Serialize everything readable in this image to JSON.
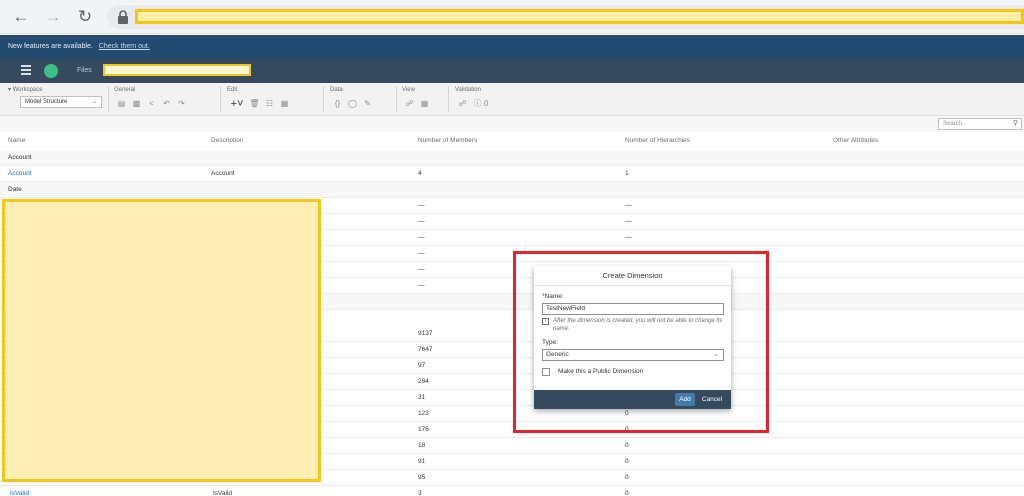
{
  "notice": {
    "text": "New features are available.",
    "link": "Check them out."
  },
  "header": {
    "breadcrumb_label": "Files"
  },
  "toolbar": {
    "workspace_label": "Workspace",
    "workspace_value": "Model Structure",
    "general_label": "General",
    "edit_label": "Edit",
    "data_label": "Data",
    "view_label": "View",
    "validation_label": "Validation",
    "validation_count": "0"
  },
  "search": {
    "placeholder": "Search"
  },
  "table": {
    "columns": [
      "Name",
      "Description",
      "Number of Members",
      "Number of Hierarchies",
      "Other Attributes"
    ],
    "group_account": "Account",
    "group_date": "Date",
    "account_row": {
      "name": "Account",
      "description": "Account",
      "members": "4",
      "hierarchies": "1"
    },
    "dash": "—",
    "members_visible": [
      "—",
      "—",
      "—",
      "—",
      "—",
      "—",
      "9137",
      "7647",
      "97",
      "284",
      "31",
      "123",
      "176",
      "18",
      "91",
      "95",
      "3"
    ],
    "hier_visible": [
      "—",
      "—",
      "—",
      "0",
      "0",
      "0",
      "0",
      "0",
      "0",
      "0"
    ],
    "last_row": {
      "name": "IsValid",
      "description": "IsValid",
      "members": "3",
      "hierarchies": "0"
    }
  },
  "dialog": {
    "title": "Create Dimension",
    "name_label": "Name:",
    "name_value": "TestNewField",
    "info_text": "After the dimension is created, you will not be able to change its name.",
    "type_label": "Type:",
    "type_value": "Generic",
    "public_label": "Make this a Public Dimension",
    "add_label": "Add",
    "cancel_label": "Cancel"
  },
  "colors": {
    "accent": "#0a6ed1",
    "header": "#354a5f",
    "notice": "#234a6f",
    "highlight": "#e8222a",
    "redaction": "#f5c518"
  }
}
